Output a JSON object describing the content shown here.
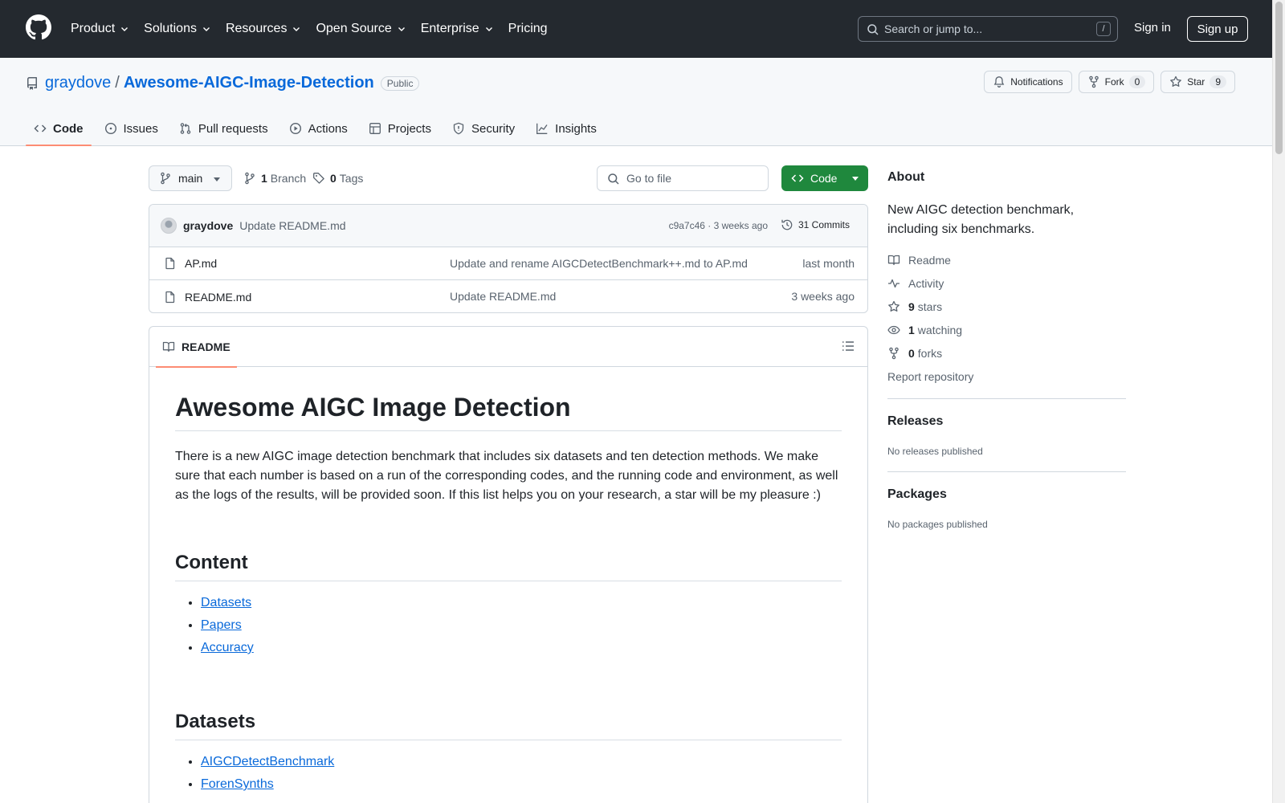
{
  "header": {
    "nav": [
      {
        "label": "Product",
        "has_menu": true
      },
      {
        "label": "Solutions",
        "has_menu": true
      },
      {
        "label": "Resources",
        "has_menu": true
      },
      {
        "label": "Open Source",
        "has_menu": true
      },
      {
        "label": "Enterprise",
        "has_menu": true
      },
      {
        "label": "Pricing",
        "has_menu": false
      }
    ],
    "search_placeholder": "Search or jump to...",
    "search_shortcut": "/",
    "signin": "Sign in",
    "signup": "Sign up"
  },
  "repo": {
    "owner": "graydove",
    "separator": "/",
    "name": "Awesome-AIGC-Image-Detection",
    "visibility": "Public",
    "notifications_label": "Notifications",
    "fork_label": "Fork",
    "fork_count": "0",
    "star_label": "Star",
    "star_count": "9",
    "tabs": [
      {
        "label": "Code",
        "icon": "code-icon",
        "active": true
      },
      {
        "label": "Issues",
        "icon": "issue-icon",
        "active": false
      },
      {
        "label": "Pull requests",
        "icon": "pull-request-icon",
        "active": false
      },
      {
        "label": "Actions",
        "icon": "play-icon",
        "active": false
      },
      {
        "label": "Projects",
        "icon": "table-icon",
        "active": false
      },
      {
        "label": "Security",
        "icon": "shield-icon",
        "active": false
      },
      {
        "label": "Insights",
        "icon": "graph-icon",
        "active": false
      }
    ]
  },
  "toolbar": {
    "branch": "main",
    "branch_count": "1",
    "branch_label": "Branch",
    "tag_count": "0",
    "tag_label": "Tags",
    "gofile_placeholder": "Go to file",
    "code_label": "Code"
  },
  "commit": {
    "author": "graydove",
    "message": "Update README.md",
    "meta": "c9a7c46 · 3 weeks ago",
    "commits_label": "31 Commits"
  },
  "files": [
    {
      "name": "AP.md",
      "message": "Update and rename AIGCDetectBenchmark++.md to AP.md",
      "date": "last month"
    },
    {
      "name": "README.md",
      "message": "Update README.md",
      "date": "3 weeks ago"
    }
  ],
  "readme": {
    "tab_label": "README",
    "h1": "Awesome AIGC Image Detection",
    "intro": "There is a new AIGC image detection benchmark that includes six datasets and ten detection methods. We make sure that each number is based on a run of the corresponding codes, and the running code and environment, as well as the logs of the results, will be provided soon. If this list helps you on your research, a star will be my pleasure :)",
    "content_heading": "Content",
    "content_links": [
      "Datasets",
      "Papers",
      "Accuracy"
    ],
    "datasets_heading": "Datasets",
    "dataset_links": [
      "AIGCDetectBenchmark",
      "ForenSynths"
    ]
  },
  "sidebar": {
    "about_title": "About",
    "description": "New AIGC detection benchmark, including six benchmarks.",
    "readme": "Readme",
    "activity": "Activity",
    "stars_count": "9",
    "stars_label": "stars",
    "watching_count": "1",
    "watching_label": "watching",
    "forks_count": "0",
    "forks_label": "forks",
    "report": "Report repository",
    "releases_title": "Releases",
    "releases_empty": "No releases published",
    "packages_title": "Packages",
    "packages_empty": "No packages published"
  }
}
